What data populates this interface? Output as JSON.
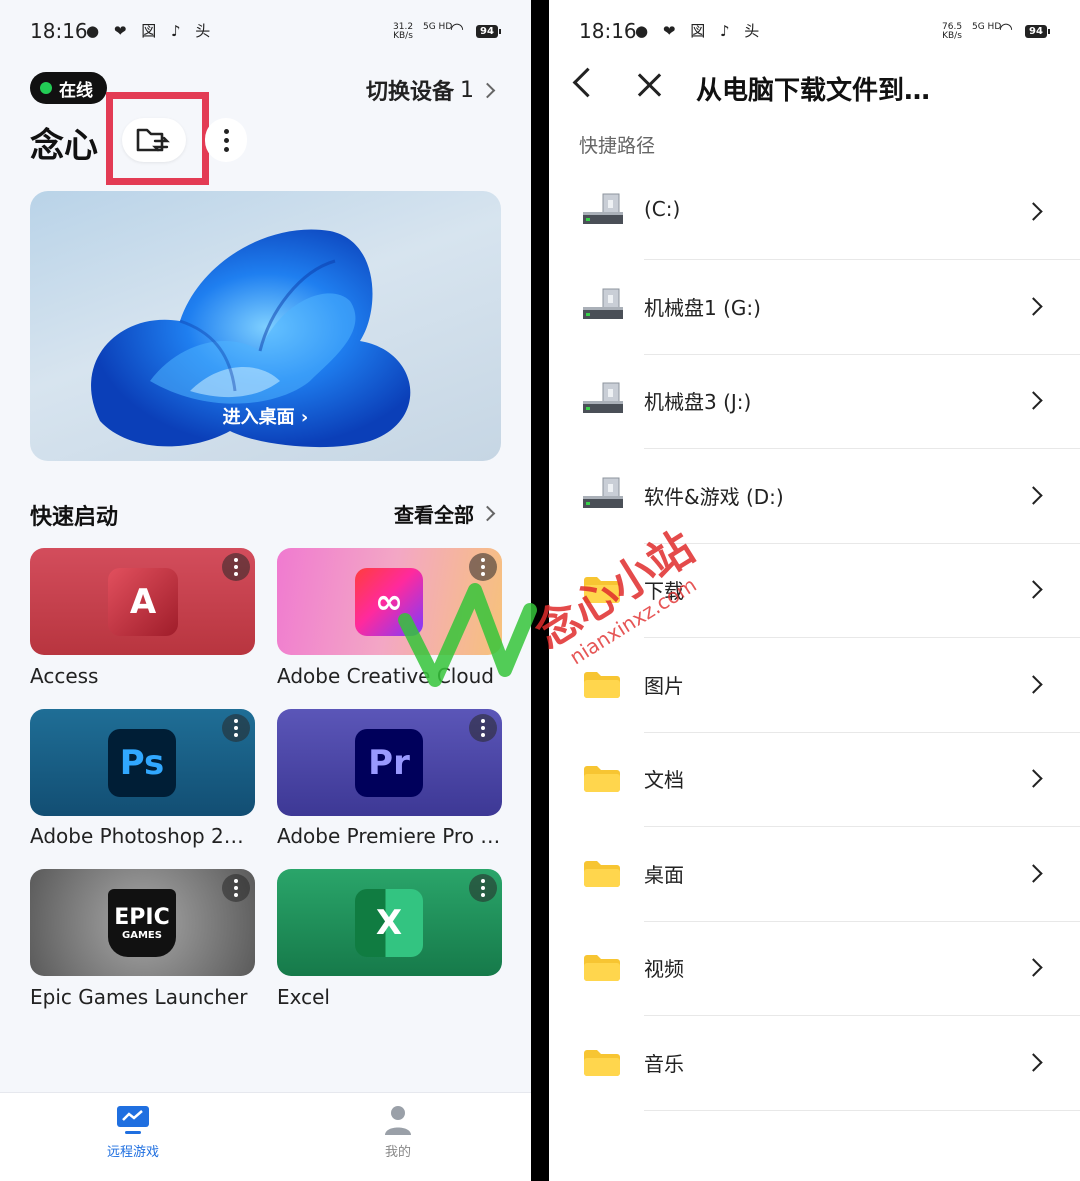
{
  "left": {
    "status": {
      "time": "18:16",
      "notifications": "● ❤ 図 ♪ 头",
      "net_speed": "31.2",
      "net_unit": "KB/s",
      "signal": "5G HD",
      "battery": "94"
    },
    "online_label": "在线",
    "switch_device": {
      "label": "切换设备",
      "count": "1"
    },
    "device_name": "念心",
    "hero_enter": "进入桌面",
    "quick_start": "快速启动",
    "view_all": "查看全部",
    "apps": [
      {
        "name": "Access",
        "glyph": "A"
      },
      {
        "name": "Adobe Creative Cloud",
        "glyph": "∞"
      },
      {
        "name": "Adobe Photoshop 2…",
        "glyph": "Ps"
      },
      {
        "name": "Adobe Premiere Pro …",
        "glyph": "Pr"
      },
      {
        "name": "Epic Games Launcher",
        "glyph": "EPIC",
        "glyph2": "GAMES"
      },
      {
        "name": "Excel",
        "glyph": "X"
      }
    ],
    "tabs": [
      {
        "label": "远程游戏",
        "active": true
      },
      {
        "label": "我的",
        "active": false
      }
    ],
    "colors": {
      "accent": "#1f6fe0",
      "highlight": "#e33b54",
      "online": "#22cc55"
    }
  },
  "right": {
    "status": {
      "time": "18:16",
      "notifications": "● ❤ 図 ♪ 头",
      "net_speed": "76.5",
      "net_unit": "KB/s",
      "signal": "5G HD",
      "battery": "94"
    },
    "title": "从电脑下载文件到…",
    "quick_paths": "快捷路径",
    "items": [
      {
        "label": "(C:)",
        "type": "drive"
      },
      {
        "label": "机械盘1 (G:)",
        "type": "drive"
      },
      {
        "label": "机械盘3 (J:)",
        "type": "drive"
      },
      {
        "label": "软件&游戏 (D:)",
        "type": "drive"
      },
      {
        "label": "下载",
        "type": "folder"
      },
      {
        "label": "图片",
        "type": "folder"
      },
      {
        "label": "文档",
        "type": "folder"
      },
      {
        "label": "桌面",
        "type": "folder"
      },
      {
        "label": "视频",
        "type": "folder"
      },
      {
        "label": "音乐",
        "type": "folder"
      }
    ]
  },
  "watermark": {
    "text": "念心小站",
    "url": "nianxinxz.com"
  }
}
